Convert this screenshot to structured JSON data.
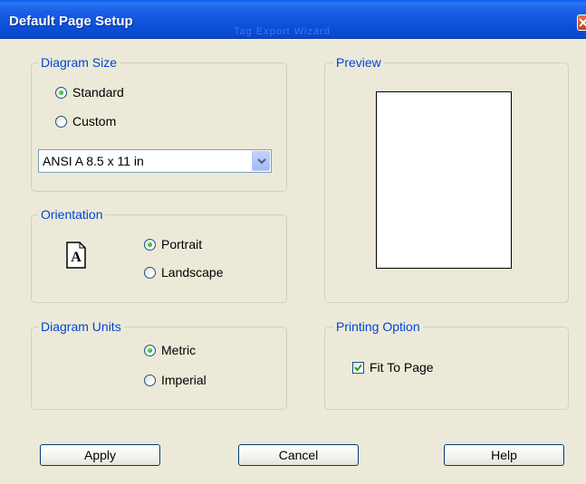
{
  "window": {
    "title": "Default Page Setup",
    "ghost_title": "Tag Export Wizard",
    "close_icon": "close-x-icon"
  },
  "diagram_size": {
    "label": "Diagram Size",
    "options": [
      {
        "label": "Standard",
        "checked": true
      },
      {
        "label": "Custom",
        "checked": false
      }
    ],
    "paper_select": {
      "value": "ANSI A 8.5 x 11 in",
      "icon": "chevron-down-icon"
    }
  },
  "orientation": {
    "label": "Orientation",
    "icon": "portrait-page-icon",
    "icon_letter": "A",
    "options": [
      {
        "label": "Portrait",
        "checked": true
      },
      {
        "label": "Landscape",
        "checked": false
      }
    ]
  },
  "diagram_units": {
    "label": "Diagram Units",
    "options": [
      {
        "label": "Metric",
        "checked": true
      },
      {
        "label": "Imperial",
        "checked": false
      }
    ]
  },
  "preview": {
    "label": "Preview"
  },
  "printing_option": {
    "label": "Printing Option",
    "fit_to_page": {
      "label": "Fit To Page",
      "checked": true
    }
  },
  "buttons": {
    "apply": "Apply",
    "cancel": "Cancel",
    "help": "Help"
  },
  "colors": {
    "title_bar": "#0a47cc",
    "group_label": "#0046d5",
    "dialog_bg": "#ece9d8",
    "check_green": "#1d9a1d"
  }
}
